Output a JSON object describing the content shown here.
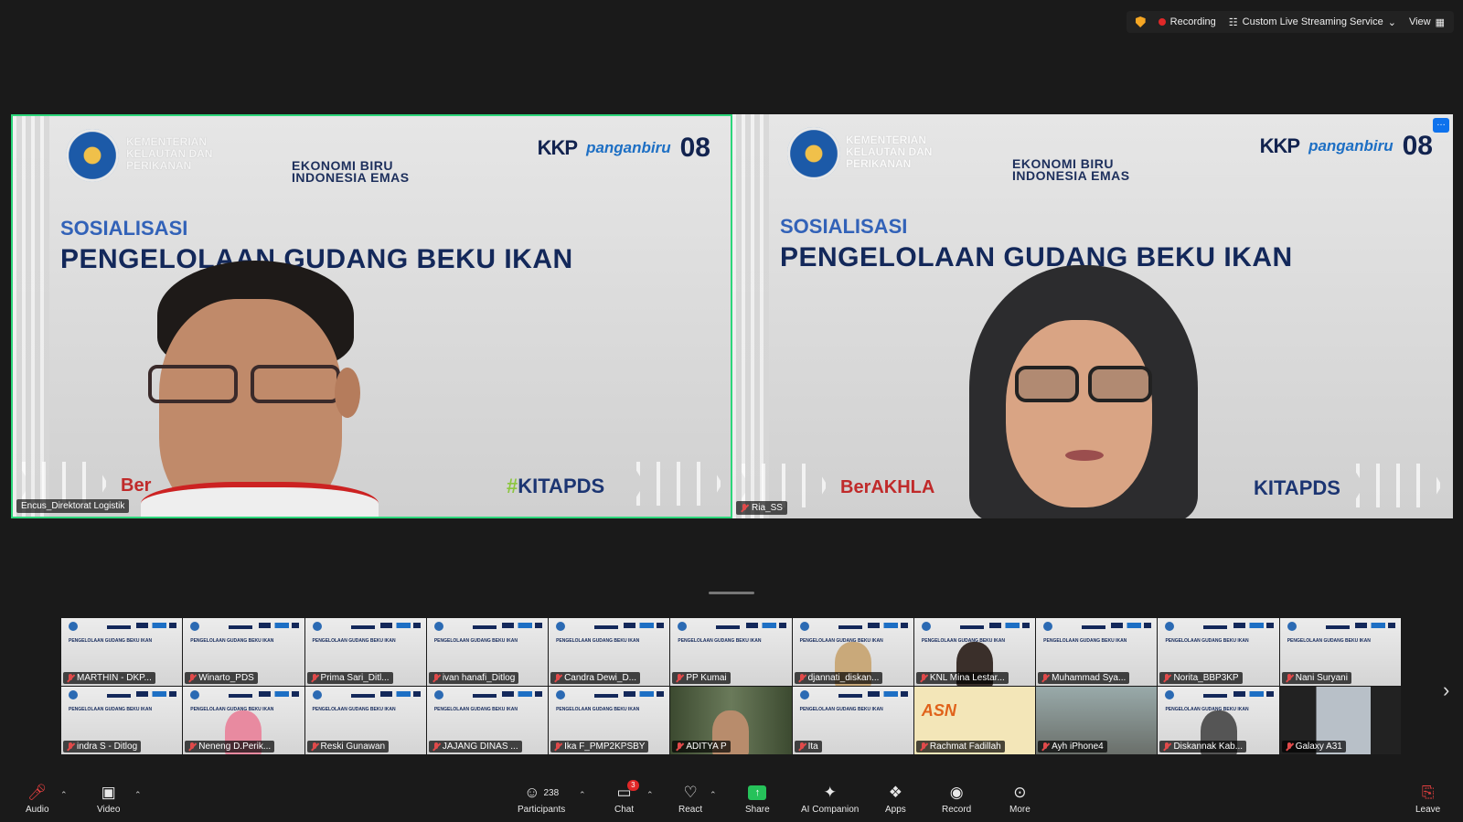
{
  "topbar": {
    "recording": "Recording",
    "streaming": "Custom Live Streaming Service",
    "view": "View"
  },
  "main_tiles": [
    {
      "name": "Encus_Direktorat Logistik",
      "slide": {
        "ministry": "KEMENTERIAN KELAUTAN DAN PERIKANAN",
        "eko_line1": "EKONOMI BIRU",
        "eko_line2": "INDONESIA EMAS",
        "kkp": "KKP",
        "panganbiru": "panganbiru",
        "o8": "08",
        "sos": "SOSIALISASI",
        "judul": "PENGELOLAAN GUDANG BEKU IKAN",
        "ber": "Ber",
        "kita_hash": "#",
        "kita": "KITAPDS"
      }
    },
    {
      "name": "Ria_SS",
      "slide": {
        "ministry": "KEMENTERIAN KELAUTAN DAN PERIKANAN",
        "eko_line1": "EKONOMI BIRU",
        "eko_line2": "INDONESIA EMAS",
        "kkp": "KKP",
        "panganbiru": "panganbiru",
        "o8": "08",
        "sos": "SOSIALISASI",
        "judul": "PENGELOLAAN GUDANG BEKU IKAN",
        "ber": "BerAKHLA",
        "kita": "KITAPDS"
      }
    }
  ],
  "gallery": {
    "mini_title": "PENGELOLAAN GUDANG BEKU IKAN",
    "participants": [
      {
        "name": "MARTHIN - DKP..."
      },
      {
        "name": "Winarto_PDS"
      },
      {
        "name": "Prima Sari_Ditl..."
      },
      {
        "name": "ivan hanafi_Ditlog"
      },
      {
        "name": "Candra Dewi_D..."
      },
      {
        "name": "PP Kumai"
      },
      {
        "name": "djannati_diskan..."
      },
      {
        "name": "KNL Mina Lestar..."
      },
      {
        "name": "Muhammad Sya..."
      },
      {
        "name": "Norita_BBP3KP"
      },
      {
        "name": "Nani Suryani"
      },
      {
        "name": "indra S - Ditlog"
      },
      {
        "name": "Neneng D.Perik..."
      },
      {
        "name": "Reski Gunawan"
      },
      {
        "name": "JAJANG DINAS ..."
      },
      {
        "name": "Ika F_PMP2KPSBY"
      },
      {
        "name": "ADITYA P"
      },
      {
        "name": "Ita"
      },
      {
        "name": "Rachmat Fadillah"
      },
      {
        "name": "Ayh iPhone4"
      },
      {
        "name": "Diskannak Kab..."
      },
      {
        "name": "Galaxy A31"
      }
    ],
    "asn_label": "ASN"
  },
  "toolbar": {
    "audio": "Audio",
    "video": "Video",
    "participants": "Participants",
    "participant_count": "238",
    "chat": "Chat",
    "chat_badge": "3",
    "react": "React",
    "share": "Share",
    "ai": "AI Companion",
    "apps": "Apps",
    "record": "Record",
    "more": "More",
    "leave": "Leave"
  },
  "colors": {
    "active_speaker_border": "#2cd67a",
    "share_green": "#26c25a",
    "record_red": "#e02828",
    "zoom_blue": "#0e72ed"
  }
}
